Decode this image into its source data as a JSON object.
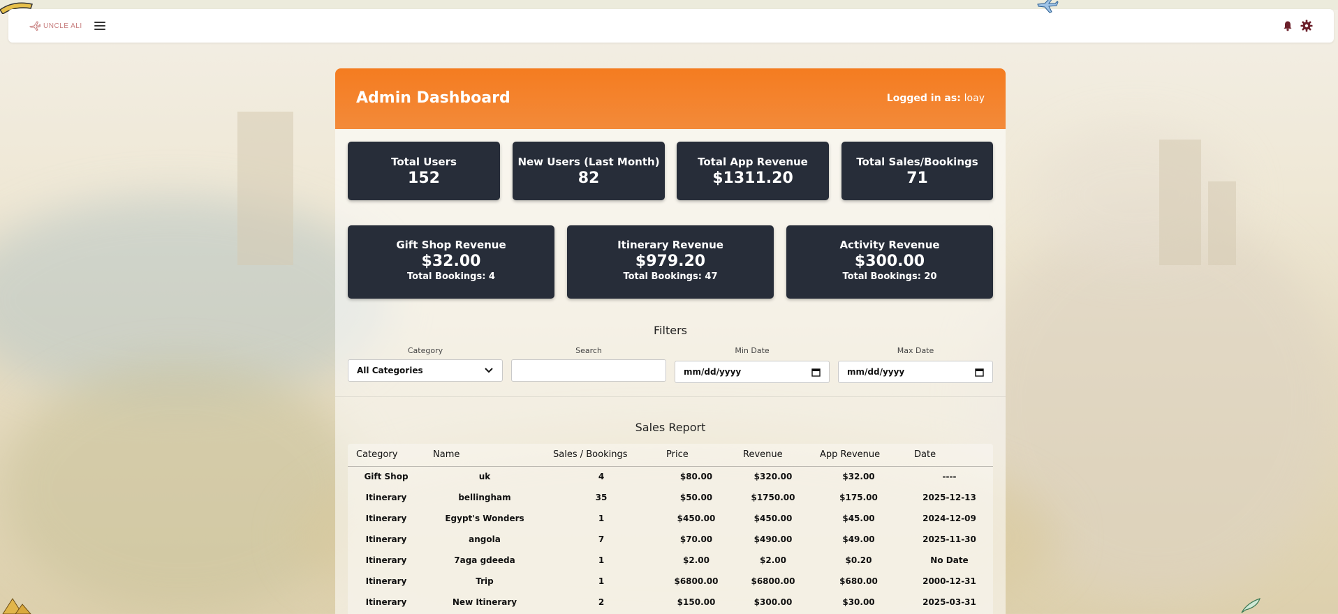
{
  "navbar": {
    "logo_text": "UNCLE ALI",
    "menu_icon": "hamburger-menu-icon",
    "notification_icon": "bell-icon",
    "settings_icon": "gear-icon"
  },
  "header": {
    "title": "Admin Dashboard",
    "logged_in_label": "Logged in as:",
    "username": "loay"
  },
  "stats": [
    {
      "label": "Total Users",
      "value": "152"
    },
    {
      "label": "New Users (Last Month)",
      "value": "82"
    },
    {
      "label": "Total App Revenue",
      "value": "$1311.20"
    },
    {
      "label": "Total Sales/Bookings",
      "value": "71"
    }
  ],
  "revenue_cards": [
    {
      "label": "Gift Shop Revenue",
      "value": "$32.00",
      "sub": "Total Bookings: 4"
    },
    {
      "label": "Itinerary Revenue",
      "value": "$979.20",
      "sub": "Total Bookings: 47"
    },
    {
      "label": "Activity Revenue",
      "value": "$300.00",
      "sub": "Total Bookings: 20"
    }
  ],
  "filters": {
    "title": "Filters",
    "category_label": "Category",
    "category_value": "All Categories",
    "search_label": "Search",
    "search_value": "",
    "min_date_label": "Min Date",
    "min_date_placeholder": "mm/dd/yyyy",
    "max_date_label": "Max Date",
    "max_date_placeholder": "mm/dd/yyyy"
  },
  "report": {
    "title": "Sales Report",
    "columns": [
      "Category",
      "Name",
      "Sales / Bookings",
      "Price",
      "Revenue",
      "App Revenue",
      "Date"
    ],
    "rows": [
      [
        "Gift Shop",
        "uk",
        "4",
        "$80.00",
        "$320.00",
        "$32.00",
        "----"
      ],
      [
        "Itinerary",
        "bellingham",
        "35",
        "$50.00",
        "$1750.00",
        "$175.00",
        "2025-12-13"
      ],
      [
        "Itinerary",
        "Egypt's Wonders",
        "1",
        "$450.00",
        "$450.00",
        "$45.00",
        "2024-12-09"
      ],
      [
        "Itinerary",
        "angola",
        "7",
        "$70.00",
        "$490.00",
        "$49.00",
        "2025-11-30"
      ],
      [
        "Itinerary",
        "7aga gdeeda",
        "1",
        "$2.00",
        "$2.00",
        "$0.20",
        "No Date"
      ],
      [
        "Itinerary",
        "Trip",
        "1",
        "$6800.00",
        "$6800.00",
        "$680.00",
        "2000-12-31"
      ],
      [
        "Itinerary",
        "New Itinerary",
        "2",
        "$150.00",
        "$300.00",
        "$30.00",
        "2025-03-31"
      ]
    ]
  },
  "colors": {
    "accent_orange": "#f47c20",
    "card_dark": "#272d39"
  }
}
